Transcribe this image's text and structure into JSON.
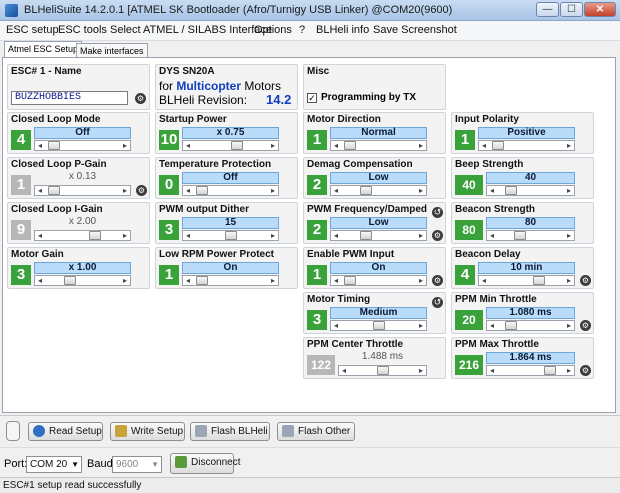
{
  "window": {
    "title": "BLHeliSuite 14.2.0.1  [ATMEL SK Bootloader (Afro/Turnigy USB Linker) @COM20(9600)",
    "minimize": "—",
    "maximize": "☐",
    "close": "✕"
  },
  "menu": [
    "ESC setup",
    "ESC tools",
    "Select ATMEL / SILABS Interface",
    "Options",
    "?",
    "BLHeli info",
    "Save Screenshot"
  ],
  "tabs": [
    "Atmel ESC Setup",
    "Make interfaces"
  ],
  "esc_name": {
    "title": "ESC# 1 - Name",
    "value": "BUZZHOBBIES"
  },
  "esc_info": {
    "model": "DYS SN20A",
    "for_label": "for",
    "firmware_type": "Multicopter",
    "motors_label": "Motors",
    "revision_label": "BLHeli Revision:",
    "revision": "14.2"
  },
  "misc": {
    "title": "Misc",
    "checkbox_label": "Programming by TX",
    "checked": true
  },
  "params": {
    "closed_loop_mode": {
      "title": "Closed Loop Mode",
      "num": "4",
      "value": "Off",
      "level": 0.05
    },
    "startup_power": {
      "title": "Startup Power",
      "num": "10",
      "value": "x 0.75",
      "level": 0.6
    },
    "motor_direction": {
      "title": "Motor Direction",
      "num": "1",
      "value": "Normal",
      "level": 0.05
    },
    "input_polarity": {
      "title": "Input Polarity",
      "num": "1",
      "value": "Positive",
      "level": 0.05
    },
    "closed_loop_p_gain": {
      "title": "Closed Loop P-Gain",
      "num": "1",
      "value": "x 0.13",
      "level": 0.05
    },
    "temperature_protection": {
      "title": "Temperature Protection",
      "num": "0",
      "value": "Off",
      "level": 0.05
    },
    "demag_compensation": {
      "title": "Demag Compensation",
      "num": "2",
      "value": "Low",
      "level": 0.3
    },
    "beep_strength": {
      "title": "Beep Strength",
      "num": "40",
      "value": "40",
      "level": 0.15
    },
    "closed_loop_i_gain": {
      "title": "Closed Loop I-Gain",
      "num": "9",
      "value": "x 2.00",
      "level": 0.7
    },
    "pwm_output_dither": {
      "title": "PWM output Dither",
      "num": "3",
      "value": "15",
      "level": 0.5
    },
    "pwm_frequency": {
      "title": "PWM Frequency/Damped",
      "num": "2",
      "value": "Low",
      "level": 0.3
    },
    "beacon_strength": {
      "title": "Beacon Strength",
      "num": "80",
      "value": "80",
      "level": 0.3
    },
    "motor_gain": {
      "title": "Motor Gain",
      "num": "3",
      "value": "x 1.00",
      "level": 0.3
    },
    "low_rpm_power_protect": {
      "title": "Low RPM Power Protect",
      "num": "1",
      "value": "On",
      "level": 0.05
    },
    "enable_pwm_input": {
      "title": "Enable PWM Input",
      "num": "1",
      "value": "On",
      "level": 0.05
    },
    "beacon_delay": {
      "title": "Beacon Delay",
      "num": "4",
      "value": "10 min",
      "level": 0.7
    },
    "motor_timing": {
      "title": "Motor Timing",
      "num": "3",
      "value": "Medium",
      "level": 0.5
    },
    "ppm_min_throttle": {
      "title": "PPM Min Throttle",
      "num": "20",
      "value": "1.080 ms",
      "level": 0.15
    },
    "ppm_center_throttle": {
      "title": "PPM Center Throttle",
      "num": "122",
      "value": "1.488 ms",
      "level": 0.5
    },
    "ppm_max_throttle": {
      "title": "PPM Max Throttle",
      "num": "216",
      "value": "1.864 ms",
      "level": 0.85
    }
  },
  "buttons": {
    "read_setup": "Read Setup",
    "write_setup": "Write Setup",
    "flash_blheli": "Flash BLHeli",
    "flash_other": "Flash Other",
    "disconnect": "Disconnect"
  },
  "port": {
    "port_label": "Port:",
    "port_value": "COM 20",
    "baud_label": "Baud:",
    "baud_value": "9600"
  },
  "status": "ESC#1 setup read successfully",
  "colors": {
    "accent_green": "#3aa23a",
    "value_blue": "#b9dcfb",
    "title_bar": "#c9dcf3"
  }
}
